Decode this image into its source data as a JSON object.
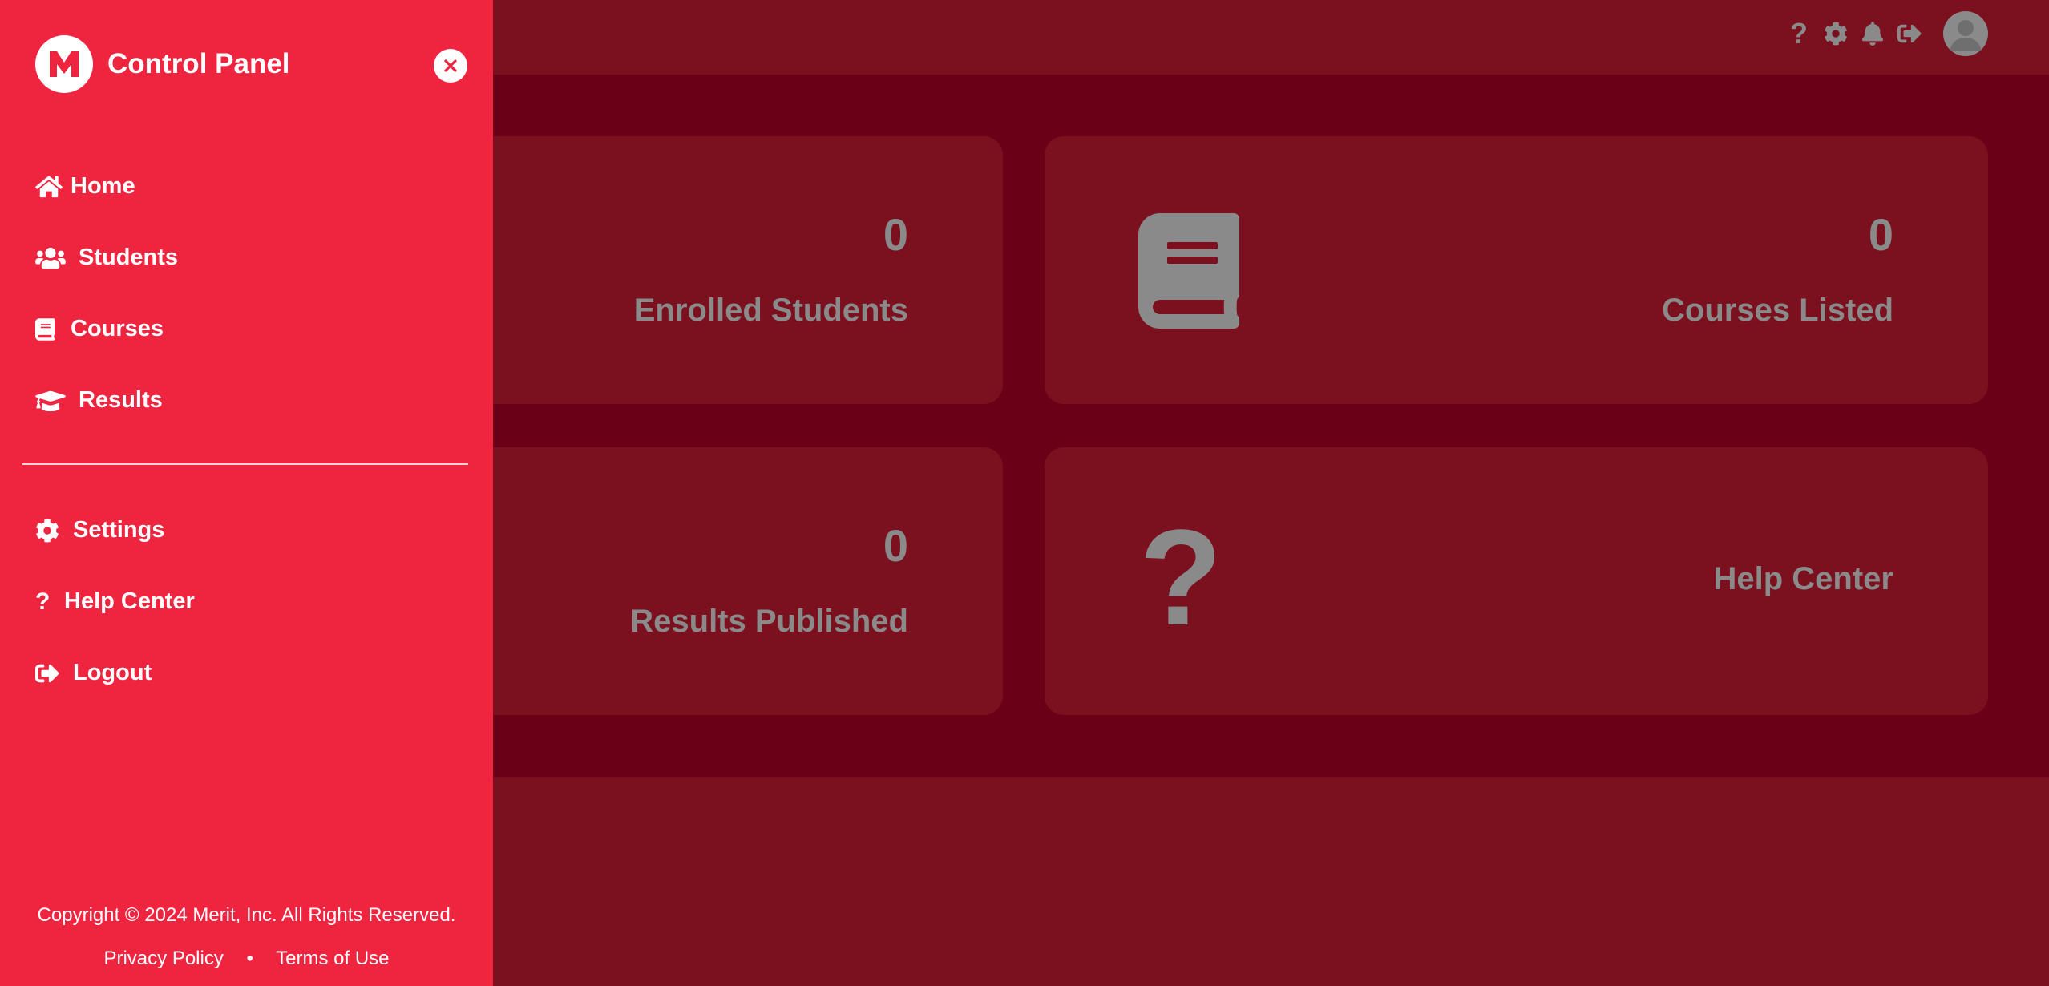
{
  "sidebar": {
    "title": "Control Panel",
    "nav_primary": [
      {
        "label": "Home",
        "icon": "home-icon"
      },
      {
        "label": "Students",
        "icon": "users-icon"
      },
      {
        "label": "Courses",
        "icon": "book-icon"
      },
      {
        "label": "Results",
        "icon": "graduation-cap-icon"
      }
    ],
    "nav_secondary": [
      {
        "label": "Settings",
        "icon": "gear-icon"
      },
      {
        "label": "Help Center",
        "icon": "question-icon"
      },
      {
        "label": "Logout",
        "icon": "logout-icon"
      }
    ],
    "copyright": "Copyright © 2024 Merit, Inc. All Rights Reserved.",
    "privacy_label": "Privacy Policy",
    "separator": "•",
    "terms_label": "Terms of Use"
  },
  "topbar": {
    "icons": [
      "question-icon",
      "gear-icon",
      "bell-icon",
      "logout-icon",
      "avatar"
    ],
    "help_glyph": "?"
  },
  "cards": [
    {
      "value": "0",
      "label": "Enrolled Students"
    },
    {
      "value": "0",
      "label": "Courses Listed",
      "icon": "book-icon"
    },
    {
      "value": "0",
      "label": "Results Published"
    },
    {
      "label": "Help Center",
      "icon": "question-icon",
      "glyph": "?"
    }
  ],
  "colors": {
    "sidebar_bg": "#ef2540",
    "overlay_bg": "#7b111f",
    "main_bg": "#6a0018",
    "muted_text": "#8a8a8a"
  }
}
